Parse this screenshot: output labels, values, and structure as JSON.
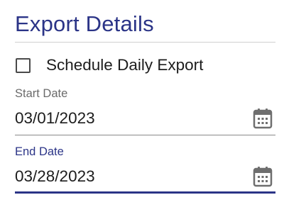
{
  "section": {
    "title": "Export Details"
  },
  "schedule": {
    "label": "Schedule Daily Export",
    "checked": false
  },
  "start_date": {
    "label": "Start Date",
    "value": "03/01/2023",
    "icon": "calendar-icon"
  },
  "end_date": {
    "label": "End Date",
    "value": "03/28/2023",
    "icon": "calendar-icon",
    "focused": true
  },
  "colors": {
    "accent": "#2b3487",
    "label_muted": "#6b6b6b",
    "text": "#1c1c1c",
    "icon": "#6e6e6e"
  }
}
